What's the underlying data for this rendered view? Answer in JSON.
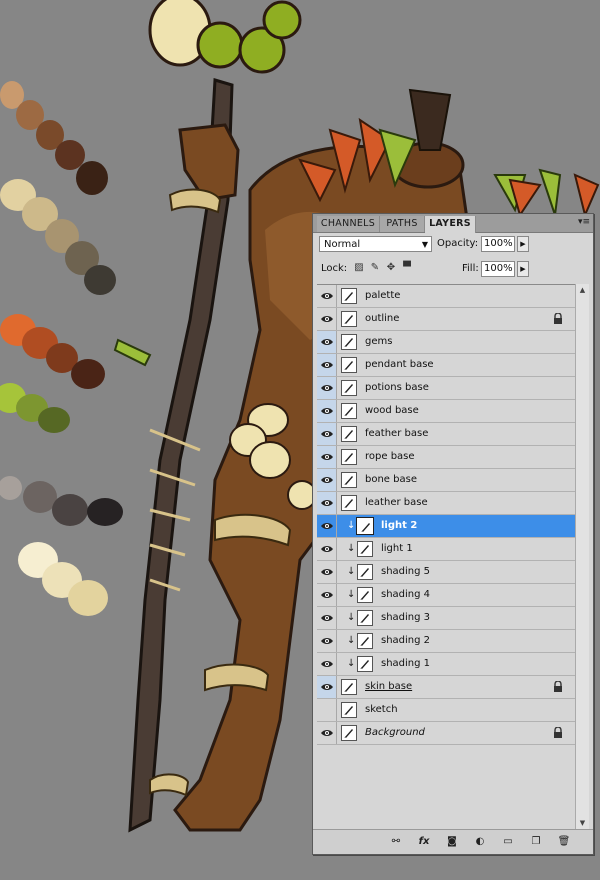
{
  "panel": {
    "tabs": [
      "CHANNELS",
      "PATHS",
      "LAYERS"
    ],
    "active_tab": "LAYERS",
    "blend_mode": "Normal",
    "opacity_label": "Opacity:",
    "opacity_value": "100%",
    "lock_label": "Lock:",
    "fill_label": "Fill:",
    "fill_value": "100%"
  },
  "layers": [
    {
      "name": "palette",
      "visible": true,
      "locked": false,
      "clipped": false,
      "style": ""
    },
    {
      "name": "outline",
      "visible": true,
      "locked": true,
      "clipped": false,
      "style": ""
    },
    {
      "name": "gems",
      "visible": true,
      "locked": false,
      "clipped": false,
      "style": ""
    },
    {
      "name": "pendant base",
      "visible": true,
      "locked": false,
      "clipped": false,
      "style": ""
    },
    {
      "name": "potions base",
      "visible": true,
      "locked": false,
      "clipped": false,
      "style": ""
    },
    {
      "name": "wood base",
      "visible": true,
      "locked": false,
      "clipped": false,
      "style": ""
    },
    {
      "name": "feather base",
      "visible": true,
      "locked": false,
      "clipped": false,
      "style": ""
    },
    {
      "name": "rope base",
      "visible": true,
      "locked": false,
      "clipped": false,
      "style": ""
    },
    {
      "name": "bone base",
      "visible": true,
      "locked": false,
      "clipped": false,
      "style": ""
    },
    {
      "name": "leather base",
      "visible": true,
      "locked": false,
      "clipped": false,
      "style": ""
    },
    {
      "name": "light 2",
      "visible": true,
      "locked": false,
      "clipped": true,
      "style": "bold",
      "selected": true
    },
    {
      "name": "light 1",
      "visible": true,
      "locked": false,
      "clipped": true,
      "style": ""
    },
    {
      "name": "shading 5",
      "visible": true,
      "locked": false,
      "clipped": true,
      "style": ""
    },
    {
      "name": "shading 4",
      "visible": true,
      "locked": false,
      "clipped": true,
      "style": ""
    },
    {
      "name": "shading 3",
      "visible": true,
      "locked": false,
      "clipped": true,
      "style": ""
    },
    {
      "name": "shading 2",
      "visible": true,
      "locked": false,
      "clipped": true,
      "style": ""
    },
    {
      "name": "shading 1",
      "visible": true,
      "locked": false,
      "clipped": true,
      "style": ""
    },
    {
      "name": "skin base",
      "visible": true,
      "locked": true,
      "clipped": false,
      "style": "underline"
    },
    {
      "name": "sketch",
      "visible": false,
      "locked": false,
      "clipped": false,
      "style": ""
    },
    {
      "name": "Background",
      "visible": true,
      "locked": true,
      "clipped": false,
      "style": "italic"
    }
  ],
  "colors": {
    "canvas_bg": "#868686",
    "selection": "#3d8ee8",
    "skin": "#7a4a22",
    "wood": "#4a3c34",
    "rope": "#d8c38a",
    "bone": "#efe3b0"
  },
  "bottom_icons": [
    "link-layers-icon",
    "fx-icon",
    "mask-icon",
    "adjustment-icon",
    "group-folder-icon",
    "new-layer-icon",
    "trash-icon"
  ]
}
